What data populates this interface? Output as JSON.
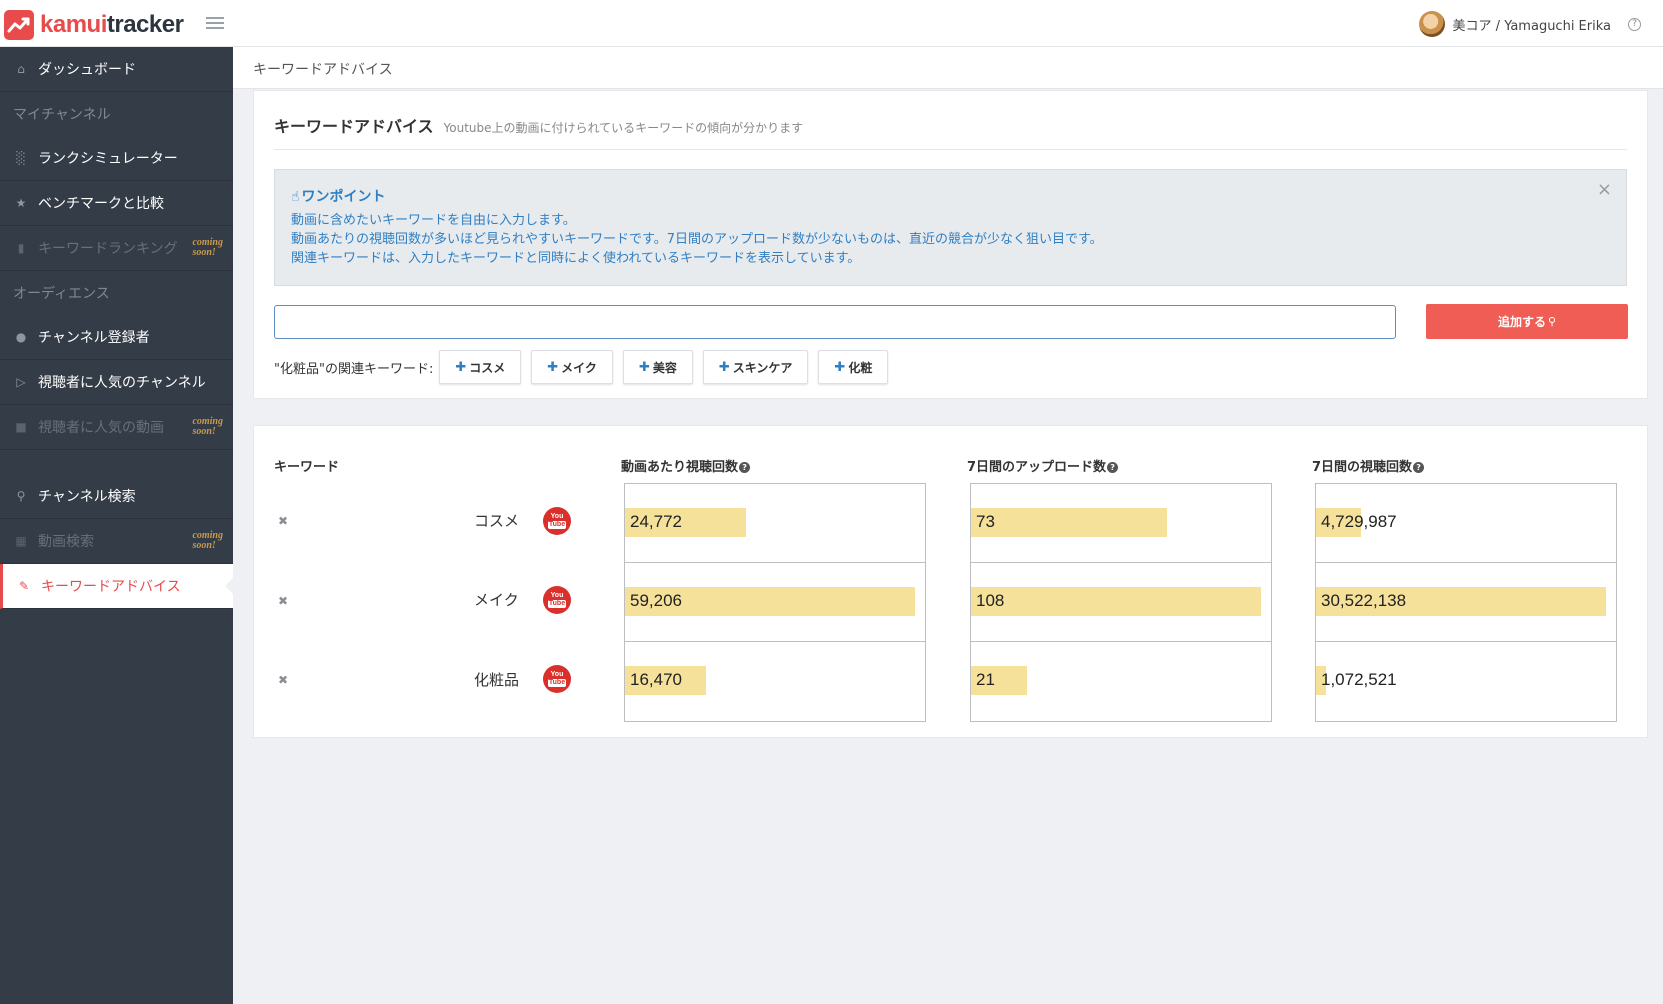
{
  "app": {
    "logo_part1": "kamui",
    "logo_part2": "tracker",
    "user_name": "美コア / Yamaguchi Erika"
  },
  "sidebar": {
    "items": [
      {
        "label": "ダッシュボード",
        "icon": "home-icon"
      },
      {
        "label": "マイチャンネル",
        "section": true
      },
      {
        "label": "ランクシミュレーター",
        "icon": "bar-chart-icon"
      },
      {
        "label": "ベンチマークと比較",
        "icon": "star-icon"
      },
      {
        "label": "キーワードランキング",
        "icon": "tag-icon",
        "disabled": true,
        "badge": "coming soon!"
      },
      {
        "label": "オーディエンス",
        "section": true
      },
      {
        "label": "チャンネル登録者",
        "icon": "users-icon"
      },
      {
        "label": "視聴者に人気のチャンネル",
        "icon": "play-screen-icon"
      },
      {
        "label": "視聴者に人気の動画",
        "icon": "video-camera-icon",
        "disabled": true,
        "badge": "coming soon!"
      },
      {
        "label": "チャンネル検索",
        "icon": "search-icon"
      },
      {
        "label": "動画検索",
        "icon": "file-search-icon",
        "disabled": true,
        "badge": "coming soon!"
      },
      {
        "label": "キーワードアドバイス",
        "icon": "pencil-icon",
        "active": true
      }
    ],
    "coming_l1": "coming",
    "coming_l2": "soon!"
  },
  "breadcrumb": "キーワードアドバイス",
  "header": {
    "title": "キーワードアドバイス",
    "subtitle": "Youtube上の動画に付けられているキーワードの傾向が分かります"
  },
  "tip": {
    "title": "ワンポイント",
    "lines": [
      "動画に含めたいキーワードを自由に入力します。",
      "動画あたりの視聴回数が多いほど見られやすいキーワードです。7日間のアップロード数が少ないものは、直近の競合が少なく狙い目です。",
      "関連キーワードは、入力したキーワードと同時によく使われているキーワードを表示しています。"
    ]
  },
  "search": {
    "value": "",
    "add_label": "追加する"
  },
  "related": {
    "label": "\"化粧品\"の関連キーワード:",
    "tags": [
      "コスメ",
      "メイク",
      "美容",
      "スキンケア",
      "化粧"
    ]
  },
  "table": {
    "headers": {
      "keyword": "キーワード",
      "views_per_video": "動画あたり視聴回数",
      "uploads_7d": "7日間のアップロード数",
      "views_7d": "7日間の視聴回数"
    },
    "youtube_you": "You",
    "youtube_tube": "Tube",
    "rows": [
      {
        "keyword": "コスメ",
        "views_per_video": "24,772",
        "uploads_7d": "73",
        "views_7d": "4,729,987"
      },
      {
        "keyword": "メイク",
        "views_per_video": "59,206",
        "uploads_7d": "108",
        "views_7d": "30,522,138"
      },
      {
        "keyword": "化粧品",
        "views_per_video": "16,470",
        "uploads_7d": "21",
        "views_7d": "1,072,521"
      }
    ]
  },
  "colors": {
    "accent": "#e84b4b",
    "sidebar_bg": "#343c47",
    "bar": "#f5e19a",
    "tip_text": "#2f7fc4"
  }
}
